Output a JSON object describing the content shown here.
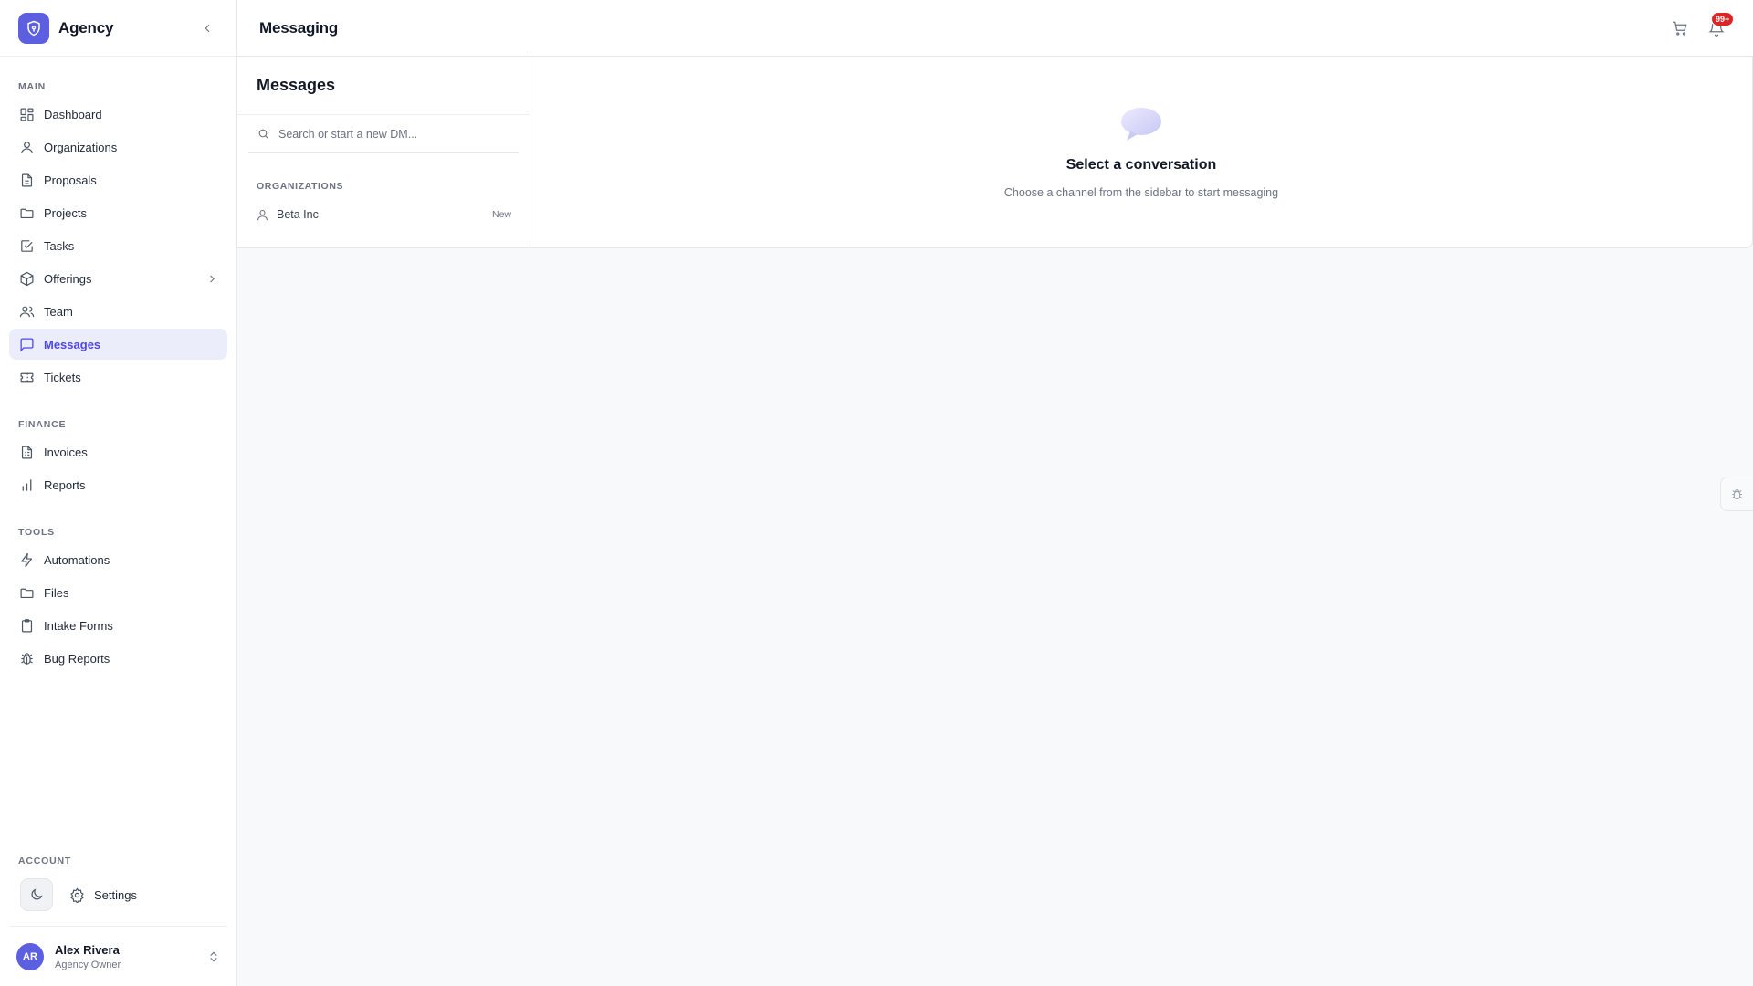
{
  "brand": {
    "name": "Agency"
  },
  "sidebar": {
    "sections": [
      {
        "label": "MAIN"
      },
      {
        "label": "FINANCE"
      },
      {
        "label": "TOOLS"
      }
    ],
    "main": [
      {
        "label": "Dashboard",
        "icon": "dashboard-icon"
      },
      {
        "label": "Organizations",
        "icon": "user-icon"
      },
      {
        "label": "Proposals",
        "icon": "document-icon"
      },
      {
        "label": "Projects",
        "icon": "folder-icon"
      },
      {
        "label": "Tasks",
        "icon": "checkbox-icon"
      },
      {
        "label": "Offerings",
        "icon": "box-icon"
      },
      {
        "label": "Team",
        "icon": "users-icon"
      },
      {
        "label": "Messages",
        "icon": "message-icon",
        "active": true
      },
      {
        "label": "Tickets",
        "icon": "ticket-icon"
      }
    ],
    "finance": [
      {
        "label": "Invoices",
        "icon": "invoice-icon"
      },
      {
        "label": "Reports",
        "icon": "bar-chart-icon"
      }
    ],
    "tools": [
      {
        "label": "Automations",
        "icon": "lightning-icon"
      },
      {
        "label": "Files",
        "icon": "folder-icon"
      },
      {
        "label": "Intake Forms",
        "icon": "clipboard-icon"
      },
      {
        "label": "Bug Reports",
        "icon": "bug-icon"
      }
    ],
    "account": {
      "label": "ACCOUNT",
      "settings": "Settings"
    }
  },
  "user": {
    "initials": "AR",
    "name": "Alex Rivera",
    "role": "Agency Owner"
  },
  "topbar": {
    "title": "Messaging",
    "badge": "99+"
  },
  "messages": {
    "title": "Messages",
    "search_placeholder": "Search or start a new DM...",
    "group_label": "ORGANIZATIONS",
    "items": [
      {
        "name": "Beta Inc",
        "tag": "New"
      }
    ]
  },
  "empty_state": {
    "title": "Select a conversation",
    "subtitle": "Choose a channel from the sidebar to start messaging"
  },
  "colors": {
    "accent": "#5b5fe0",
    "active_bg": "#ebedfb",
    "badge": "#dc2626"
  }
}
